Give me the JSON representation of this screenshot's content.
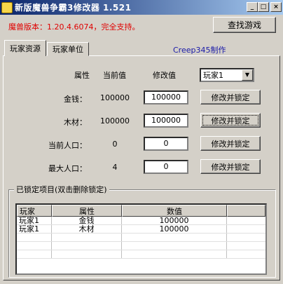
{
  "window": {
    "title": "新版魔兽争霸3修改器 1.521"
  },
  "header": {
    "version_text": "魔兽版本：1.20.4.6074，完全支持。",
    "search_button": "查找游戏"
  },
  "tabs": [
    {
      "label": "玩家资源"
    },
    {
      "label": "玩家单位"
    }
  ],
  "credit": "Creep345制作",
  "table_header": {
    "attribute": "属性",
    "current": "当前值",
    "modify": "修改值",
    "player_selected": "玩家1"
  },
  "rows": [
    {
      "label": "金钱：",
      "current": "100000",
      "input": "100000",
      "button": "修改并锁定"
    },
    {
      "label": "木材：",
      "current": "100000",
      "input": "100000",
      "button": "修改并锁定"
    },
    {
      "label": "当前人口：",
      "current": "0",
      "input": "0",
      "button": "修改并锁定"
    },
    {
      "label": "最大人口：",
      "current": "4",
      "input": "0",
      "button": "修改并锁定"
    }
  ],
  "locked": {
    "title": "已锁定项目(双击删除锁定)",
    "columns": [
      "玩家",
      "属性",
      "数值"
    ],
    "items": [
      {
        "player": "玩家1",
        "attribute": "金钱",
        "value": "100000"
      },
      {
        "player": "玩家1",
        "attribute": "木材",
        "value": "100000"
      }
    ]
  }
}
